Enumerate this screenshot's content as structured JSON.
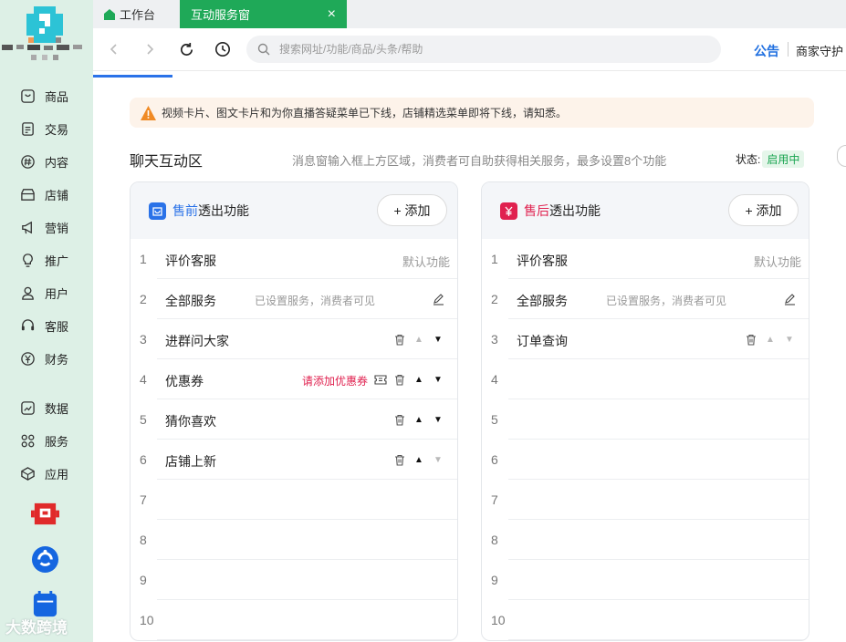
{
  "sidebar": {
    "shop_name": "",
    "items": [
      {
        "label": "商品",
        "icon": "product-icon"
      },
      {
        "label": "交易",
        "icon": "trade-icon"
      },
      {
        "label": "内容",
        "icon": "content-icon"
      },
      {
        "label": "店铺",
        "icon": "shop-icon"
      },
      {
        "label": "营销",
        "icon": "marketing-icon"
      },
      {
        "label": "推广",
        "icon": "promotion-icon"
      },
      {
        "label": "用户",
        "icon": "user-icon"
      },
      {
        "label": "客服",
        "icon": "customer-service-icon"
      },
      {
        "label": "财务",
        "icon": "finance-icon"
      },
      {
        "label": "数据",
        "icon": "data-icon"
      },
      {
        "label": "服务",
        "icon": "service-icon"
      },
      {
        "label": "应用",
        "icon": "app-icon"
      }
    ],
    "watermark": "大数跨境"
  },
  "tabs": {
    "home": "工作台",
    "active": "互动服务窗",
    "close": "×"
  },
  "toolbar": {
    "search_placeholder": "搜索网址/功能/商品/头条/帮助",
    "notice": "公告",
    "guard": "商家守护"
  },
  "alert": {
    "text": "视频卡片、图文卡片和为你直播答疑菜单已下线，店铺精选菜单即将下线，请知悉。"
  },
  "section": {
    "title": "聊天互动区",
    "desc": "消息窗输入框上方区域，消费者可自助获得相关服务，最多设置8个功能",
    "status_label": "状态:",
    "status_value": "启用中"
  },
  "presale": {
    "title_highlight": "售前",
    "title_rest": "透出功能",
    "add_label": "+ 添加",
    "rows": [
      {
        "n": "1",
        "name": "评价客服",
        "note": "",
        "def": "默认功能",
        "coupon": ""
      },
      {
        "n": "2",
        "name": "全部服务",
        "note": "已设置服务，消费者可见",
        "def": "",
        "coupon": ""
      },
      {
        "n": "3",
        "name": "进群问大家",
        "note": "",
        "def": "",
        "coupon": ""
      },
      {
        "n": "4",
        "name": "优惠券",
        "note": "",
        "def": "",
        "coupon": "请添加优惠券"
      },
      {
        "n": "5",
        "name": "猜你喜欢",
        "note": "",
        "def": "",
        "coupon": ""
      },
      {
        "n": "6",
        "name": "店铺上新",
        "note": "",
        "def": "",
        "coupon": ""
      },
      {
        "n": "7",
        "name": "",
        "note": "",
        "def": "",
        "coupon": ""
      },
      {
        "n": "8",
        "name": "",
        "note": "",
        "def": "",
        "coupon": ""
      },
      {
        "n": "9",
        "name": "",
        "note": "",
        "def": "",
        "coupon": ""
      },
      {
        "n": "10",
        "name": "",
        "note": "",
        "def": "",
        "coupon": ""
      }
    ]
  },
  "aftersale": {
    "title_highlight": "售后",
    "title_rest": "透出功能",
    "add_label": "+ 添加",
    "rows": [
      {
        "n": "1",
        "name": "评价客服",
        "note": "",
        "def": "默认功能",
        "coupon": ""
      },
      {
        "n": "2",
        "name": "全部服务",
        "note": "已设置服务，消费者可见",
        "def": "",
        "coupon": ""
      },
      {
        "n": "3",
        "name": "订单查询",
        "note": "",
        "def": "",
        "coupon": ""
      },
      {
        "n": "4",
        "name": "",
        "note": "",
        "def": "",
        "coupon": ""
      },
      {
        "n": "5",
        "name": "",
        "note": "",
        "def": "",
        "coupon": ""
      },
      {
        "n": "6",
        "name": "",
        "note": "",
        "def": "",
        "coupon": ""
      },
      {
        "n": "7",
        "name": "",
        "note": "",
        "def": "",
        "coupon": ""
      },
      {
        "n": "8",
        "name": "",
        "note": "",
        "def": "",
        "coupon": ""
      },
      {
        "n": "9",
        "name": "",
        "note": "",
        "def": "",
        "coupon": ""
      },
      {
        "n": "10",
        "name": "",
        "note": "",
        "def": "",
        "coupon": ""
      }
    ]
  },
  "colors": {
    "brand_green": "#1fa958",
    "blue": "#2a72e8",
    "red": "#e0214f",
    "sidebar_bg": "#ddf0e6"
  }
}
